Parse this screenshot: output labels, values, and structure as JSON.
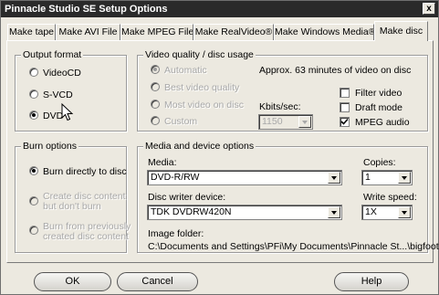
{
  "window": {
    "title": "Pinnacle Studio SE Setup Options"
  },
  "close_glyph": "x",
  "tabs": [
    {
      "label": "Make tape"
    },
    {
      "label": "Make AVI File"
    },
    {
      "label": "Make MPEG File"
    },
    {
      "label": "Make RealVideo®"
    },
    {
      "label": "Make Windows Media®"
    },
    {
      "label": "Make disc",
      "active": true
    }
  ],
  "output_format": {
    "title": "Output format",
    "options": [
      {
        "label": "VideoCD",
        "selected": false
      },
      {
        "label": "S-VCD",
        "selected": false
      },
      {
        "label": "DVD",
        "selected": true
      }
    ]
  },
  "video_quality": {
    "title": "Video quality / disc usage",
    "options": [
      {
        "label": "Automatic",
        "selected": true,
        "disabled": true
      },
      {
        "label": "Best video quality",
        "selected": false,
        "disabled": true
      },
      {
        "label": "Most video on disc",
        "selected": false,
        "disabled": true
      },
      {
        "label": "Custom",
        "selected": false,
        "disabled": true
      }
    ],
    "approx_text": "Approx. 63 minutes of video on disc",
    "kbits_label": "Kbits/sec:",
    "kbits_value": "1150",
    "checkboxes": [
      {
        "label": "Filter video",
        "checked": false
      },
      {
        "label": "Draft mode",
        "checked": false
      },
      {
        "label": "MPEG audio",
        "checked": true
      }
    ]
  },
  "burn_options": {
    "title": "Burn options",
    "options": [
      {
        "label": "Burn directly to disc",
        "selected": true,
        "disabled": false
      },
      {
        "label_line1": "Create disc content",
        "label_line2": "but don't burn",
        "selected": false,
        "disabled": true
      },
      {
        "label_line1": "Burn from previously",
        "label_line2": "created disc content",
        "selected": false,
        "disabled": true
      }
    ]
  },
  "media_device": {
    "title": "Media and device options",
    "media_label": "Media:",
    "media_value": "DVD-R/RW",
    "copies_label": "Copies:",
    "copies_value": "1",
    "writer_label": "Disc writer device:",
    "writer_value": "TDK  DVDRW420N",
    "speed_label": "Write speed:",
    "speed_value": "1X",
    "folder_label": "Image folder:",
    "folder_path": "C:\\Documents and Settings\\PFi\\My Documents\\Pinnacle St...\\bigfoot"
  },
  "buttons": {
    "ok": "OK",
    "cancel": "Cancel",
    "help": "Help"
  },
  "colors": {
    "titlebar": "#2a2a2a",
    "face": "#ece9e0",
    "disabled_text": "#a8a8a8"
  }
}
